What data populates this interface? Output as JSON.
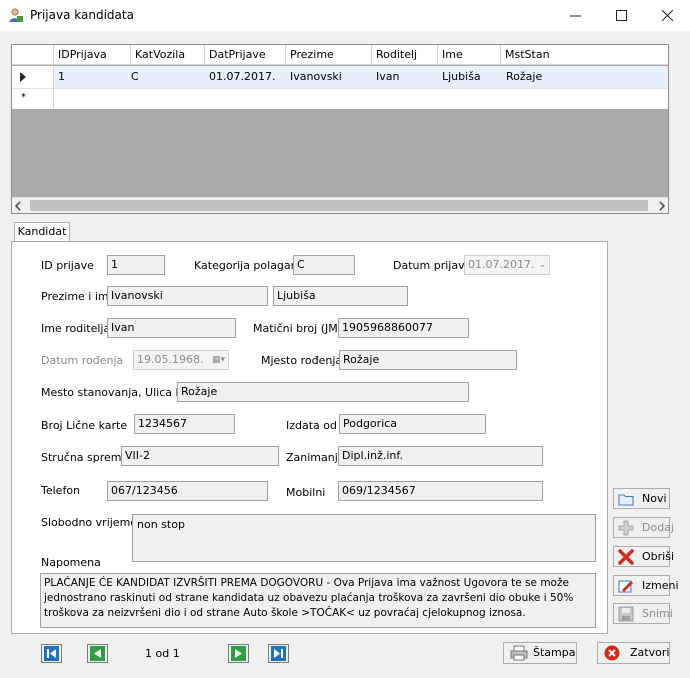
{
  "window": {
    "title": "Prijava kandidata"
  },
  "grid": {
    "columns": [
      "IDPrijava",
      "KatVozila",
      "DatPrijave",
      "Prezime",
      "Roditelj",
      "Ime",
      "MstStan"
    ],
    "rows": [
      [
        "1",
        "C",
        "01.07.2017.",
        "Ivanovski",
        "Ivan",
        "Ljubiša",
        "Rožaje"
      ]
    ],
    "new_row_marker": "*"
  },
  "tab": {
    "label": "Kandidat"
  },
  "form": {
    "id_label": "ID prijave",
    "id_value": "1",
    "kategorija_label": "Kategorija polaganja",
    "kategorija_value": "C",
    "datum_prijave_label": "Datum prijave",
    "datum_prijave_value": "01.07.2017.",
    "prezime_ime_label": "Prezime i ime",
    "prezime_value": "Ivanovski",
    "ime_value": "Ljubiša",
    "roditelj_label": "Ime roditelja",
    "roditelj_value": "Ivan",
    "jmb_label": "Matični broj (JMB)",
    "jmb_value": "1905968860077",
    "datum_rodjenja_label": "Datum rođenja",
    "datum_rodjenja_value": "19.05.1968.",
    "mjesto_rodjenja_label": "Mjesto rođenja",
    "mjesto_rodjenja_value": "Rožaje",
    "mesto_stanovanja_label": "Mesto stanovanja, Ulica br.",
    "mesto_stanovanja_value": "Rožaje",
    "licna_karta_label": "Broj Lične karte",
    "licna_karta_value": "1234567",
    "izdata_label": "Izdata od",
    "izdata_value": "Podgorica",
    "sprema_label": "Stručna sprema",
    "sprema_value": "VII-2",
    "zanimanje_label": "Zanimanje",
    "zanimanje_value": "Dipl.inž.inf.",
    "telefon_label": "Telefon",
    "telefon_value": "067/123456",
    "mobilni_label": "Mobilni",
    "mobilni_value": "069/1234567",
    "slobodno_label": "Slobodno vrijeme",
    "slobodno_value": "non stop",
    "napomena_label": "Napomena",
    "napomena_value": "PLAĆANJE ĆE KANDIDAT IZVRŠITI PREMA DOGOVORU - Ova Prijava ima važnost Ugovora  te se može jednostrano raskinuti od strane kandidata uz obavezu plaćanja troškova za završeni dio obuke i 50% troškova za neizvršeni dio i od strane Auto škole >TOČAK< uz povraćaj cjelokupnog iznosa."
  },
  "side_buttons": {
    "novi": "Novi",
    "dodaj": "Dodaj",
    "obrisi": "Obriši",
    "izmeni": "Izmeni",
    "snimi": "Snimi"
  },
  "navigation": {
    "page_info": "1 od 1"
  },
  "bottom_buttons": {
    "stampa": "Štampa",
    "zatvori": "Zatvori"
  },
  "colors": {
    "accent": "#1e73be",
    "nav_green": "#2ea043",
    "close_red": "#d42a1c",
    "selection": "#e6f0fb"
  }
}
